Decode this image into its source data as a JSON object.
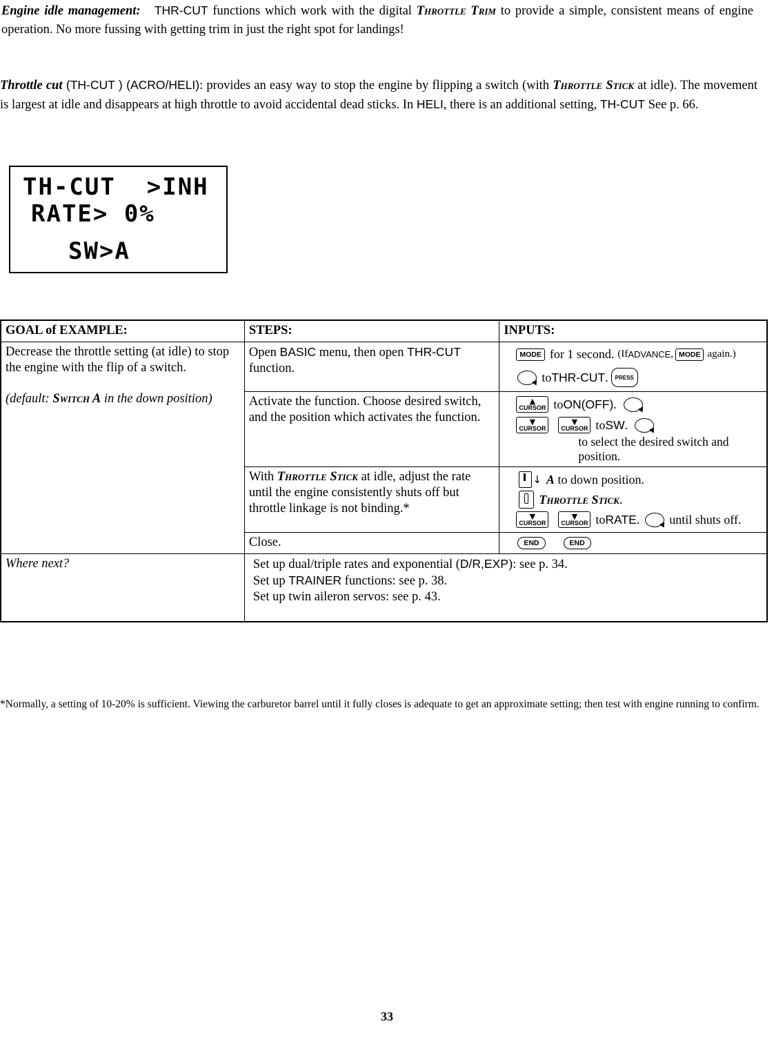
{
  "intro": {
    "idle_label": "Engine idle management:",
    "idle_text_1": "THR-CUT",
    "idle_text_2": " functions which work with the digital ",
    "idle_sc_1": "Throttle Trim",
    "idle_text_3": " to provide a simple, consistent means of engine operation. No more fussing with getting trim in just the right spot for landings!",
    "thcut_label": "Throttle cut",
    "thcut_paren1": " (TH-CUT ) (ACRO/HELI)",
    "thcut_text_1": ": provides an easy way to stop the engine by flipping a switch (with ",
    "thcut_sc_1": "Throttle Stick",
    "thcut_text_2": " at idle). The movement is largest at idle and disappears at high throttle to avoid accidental dead sticks. In ",
    "thcut_heli": "HELI",
    "thcut_text_3": ", there is an additional setting, ",
    "thcut_thcut": "TH-CUT",
    "thcut_text_4": "  See p. 66."
  },
  "lcd": {
    "line1": "TH-CUT  >INH",
    "line2": "RATE> 0%",
    "line3": "SW>A"
  },
  "table": {
    "headers": {
      "goal": "GOAL of EXAMPLE:",
      "steps": "STEPS:",
      "inputs": "INPUTS:"
    },
    "goal": {
      "text": "Decrease the throttle setting (at idle) to stop the engine with the flip of a switch.",
      "default_prefix": "(default: ",
      "default_sc": "Switch A",
      "default_suffix": " in the down position)"
    },
    "rows": [
      {
        "step_plain_1": "Open ",
        "step_sans_1": "BASIC",
        "step_plain_2": " menu, then open ",
        "step_sans_2": "THR-CUT",
        "step_plain_3": " function.",
        "inputs": {
          "key_mode": "MODE",
          "text_1": "for 1 second.",
          "text_2": "(If ",
          "text_advance": "ADVANCE",
          "text_3": ",",
          "key_mode_2": "MODE",
          "text_4": "again.)",
          "text_5": "to ",
          "text_thrcut": "THR-CUT",
          "text_6": ".",
          "key_press": "PRESS"
        }
      },
      {
        "step_text": "Activate the function. Choose desired switch, and the position which activates the function.",
        "inputs": {
          "key_cursor": "CURSOR",
          "text_on": "to ",
          "text_onoff": "ON(OFF)",
          "text_onoff_dot": ".",
          "text_sw": "to ",
          "text_sw_val": "SW",
          "text_sw_dot": ".",
          "note": "to select the desired switch and position."
        }
      },
      {
        "step_plain_1": "With ",
        "step_sc": "Throttle Stick",
        "step_plain_2": " at idle, adjust the rate until the engine consistently shuts off but throttle linkage is not binding.*",
        "inputs": {
          "switch_a": "A",
          "text_a": " to down position.",
          "sc_stick": "Throttle Stick",
          "stick_dot": ".",
          "key_cursor": "CURSOR",
          "text_rate_pre": "to ",
          "text_rate": "RATE",
          "text_rate_dot": ".",
          "text_until": "until shuts off."
        }
      },
      {
        "step_text": "Close.",
        "inputs": {
          "key_end": "END"
        }
      }
    ],
    "where_next": {
      "label": "Where next?",
      "line1_a": "Set up dual/triple rates and exponential (",
      "line1_sans": "D/R,EXP",
      "line1_b": "): see p. 34.",
      "line2_a": "Set up ",
      "line2_sans": "TRAINER",
      "line2_b": " functions: see p. 38.",
      "line3": "Set up twin aileron servos: see p. 43."
    }
  },
  "footnote": "*Normally, a setting of 10-20% is sufficient. Viewing the carburetor barrel until it fully closes is adequate to get an approximate setting; then test with engine running to confirm.",
  "page_number": "33"
}
